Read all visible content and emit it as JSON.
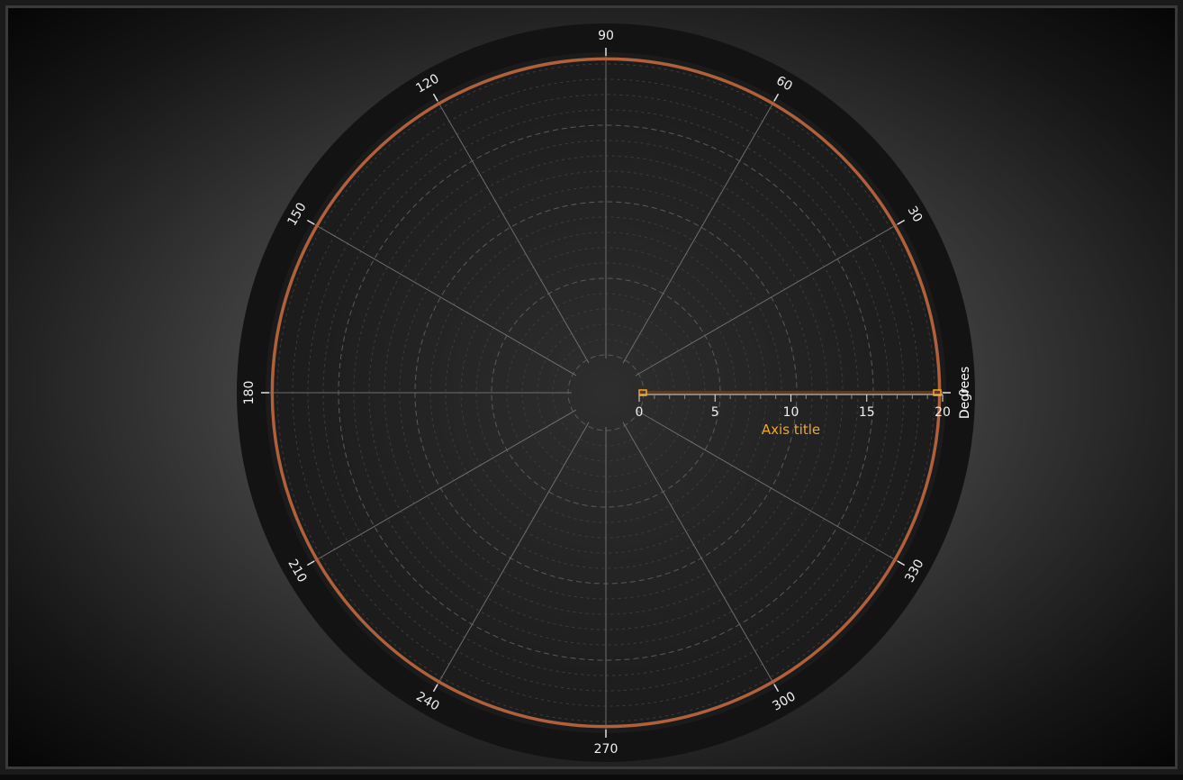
{
  "chart_data": {
    "type": "polar",
    "angular_axis": {
      "title": "Degrees",
      "range": [
        0,
        360
      ],
      "tick_labels": [
        "0",
        "30",
        "60",
        "90",
        "120",
        "150",
        "180",
        "210",
        "240",
        "270",
        "300",
        "330"
      ],
      "tick_values": [
        0,
        30,
        60,
        90,
        120,
        150,
        180,
        210,
        240,
        270,
        300,
        330
      ]
    },
    "radial_axis": {
      "title": "Axis title",
      "range": [
        0,
        20
      ],
      "tick_labels": [
        "0",
        "5",
        "10",
        "15",
        "20"
      ],
      "tick_values": [
        0,
        5,
        10,
        15,
        20
      ]
    },
    "series": [
      {
        "type": "circle",
        "radius": 19.8,
        "angle_range": [
          0,
          360
        ]
      }
    ],
    "grid": true,
    "colors": {
      "series": "#b0603a",
      "axis_title": "#f5a623",
      "plot_background": "#1c1c1c",
      "outer_ring": "#131313"
    }
  }
}
